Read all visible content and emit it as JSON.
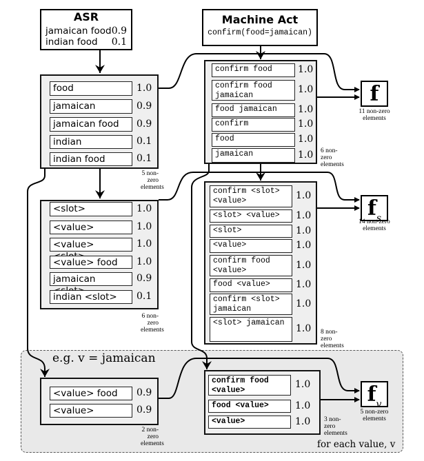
{
  "asr": {
    "title": "ASR",
    "items": [
      {
        "text": "jamaican food",
        "score": "0.9"
      },
      {
        "text": "indian food",
        "score": "0.1"
      }
    ]
  },
  "machine_act": {
    "title": "Machine Act",
    "act": "confirm(food=jamaican)"
  },
  "asr_ngrams": {
    "rows": [
      {
        "text": "food",
        "score": "1.0"
      },
      {
        "text": "jamaican",
        "score": "0.9"
      },
      {
        "text": "jamaican food",
        "score": "0.9"
      },
      {
        "text": "indian",
        "score": "0.1"
      },
      {
        "text": "indian food",
        "score": "0.1"
      }
    ],
    "note": "5 non-zero elements"
  },
  "act_ngrams": {
    "rows": [
      {
        "text": "confirm food",
        "score": "1.0"
      },
      {
        "text": "confirm food jamaican",
        "score": "1.0"
      },
      {
        "text": "food jamaican",
        "score": "1.0"
      },
      {
        "text": "confirm",
        "score": "1.0"
      },
      {
        "text": "food",
        "score": "1.0"
      },
      {
        "text": "jamaican",
        "score": "1.0"
      }
    ],
    "note": "6 non-zero elements"
  },
  "f": {
    "label": "f",
    "sub": "",
    "note": "11 non-zero elements"
  },
  "asr_slot": {
    "rows": [
      {
        "text": "<slot>",
        "score": "1.0"
      },
      {
        "text": "<value>",
        "score": "1.0"
      },
      {
        "text": "<value> <slot>",
        "score": "1.0"
      },
      {
        "text": "<value> food",
        "score": "1.0"
      },
      {
        "text": "jamaican <slot>",
        "score": "0.9"
      },
      {
        "text": "indian <slot>",
        "score": "0.1"
      }
    ],
    "note": "6 non-zero elements"
  },
  "act_slot": {
    "rows": [
      {
        "text": "confirm <slot> <value>",
        "score": "1.0"
      },
      {
        "text": "<slot> <value>",
        "score": "1.0"
      },
      {
        "text": "<slot>",
        "score": "1.0"
      },
      {
        "text": "<value>",
        "score": "1.0"
      },
      {
        "text": "confirm food <value>",
        "score": "1.0"
      },
      {
        "text": "food <value>",
        "score": "1.0"
      },
      {
        "text": "confirm <slot> jamaican",
        "score": "1.0"
      },
      {
        "text": "<slot> jamaican",
        "score": "1.0"
      }
    ],
    "note": "8 non-zero elements"
  },
  "fs": {
    "label": "f",
    "sub": "s",
    "note": "14 non-zero elements"
  },
  "value_region": {
    "example": "e.g. v = jamaican",
    "caption": "for each value, v"
  },
  "asr_value": {
    "rows": [
      {
        "text": "<value> food",
        "score": "0.9"
      },
      {
        "text": "<value>",
        "score": "0.9"
      }
    ],
    "note": "2 non-zero elements"
  },
  "act_value": {
    "rows": [
      {
        "text": "confirm food <value>",
        "score": "1.0"
      },
      {
        "text": "food <value>",
        "score": "1.0"
      },
      {
        "text": "<value>",
        "score": "1.0"
      }
    ],
    "note": "3 non-zero elements"
  },
  "fv": {
    "label": "f",
    "sub": "v",
    "note": "5 non-zero elements"
  }
}
